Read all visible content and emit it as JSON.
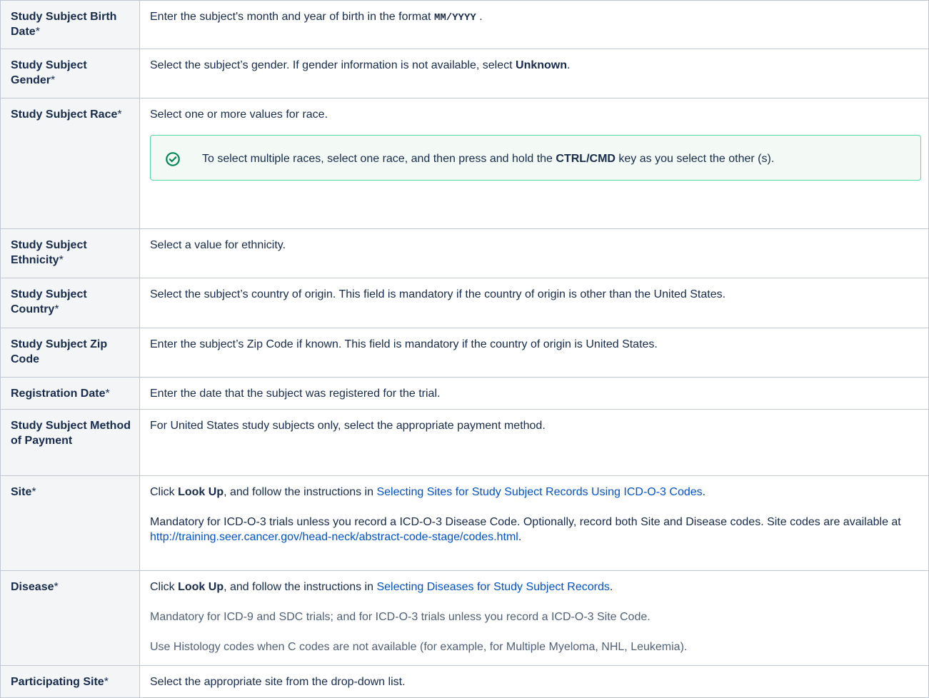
{
  "rows": [
    {
      "label": "Study Subject Birth Date",
      "req": "*",
      "desc_pre": "Enter the subject's month and year of birth in the format ",
      "desc_code": "MM/YYYY",
      "desc_post": " ."
    },
    {
      "label": "Study Subject Gender",
      "req": "*",
      "desc_pre": "Select the subject’s gender. If gender information is not available, select ",
      "desc_bold": "Unknown",
      "desc_post": "."
    },
    {
      "label": "Study Subject Race",
      "req": "*",
      "desc": "Select one or more values for race.",
      "tip_pre": "To select multiple races, select one race, and then press and hold the ",
      "tip_bold": "CTRL/CMD",
      "tip_post": " key as you select the other (s).",
      "tip_icon": "check-circle-icon",
      "tip_color": "#00875a"
    },
    {
      "label": "Study Subject Ethnicity",
      "req": "*",
      "desc": "Select a value for ethnicity."
    },
    {
      "label": "Study Subject Country",
      "req": "*",
      "desc": "Select the subject’s country of origin. This field is mandatory if the country of origin is other than the United States."
    },
    {
      "label": "Study Subject Zip Code",
      "req": "",
      "desc": "Enter the subject’s Zip Code if known. This field is mandatory if the country of origin is United States."
    },
    {
      "label": "Registration Date",
      "req": "*",
      "desc": "Enter the date that the subject was registered for the trial."
    },
    {
      "label": "Study Subject Method of Payment",
      "req": "",
      "desc": "For United States study subjects only, select the appropriate payment method."
    },
    {
      "label": "Site",
      "req": "*",
      "p1_pre": "Click ",
      "p1_bold": "Look Up",
      "p1_mid": ", and follow the instructions in ",
      "p1_link": "Selecting Sites for Study Subject Records Using ICD-O-3 Codes",
      "p1_post": ".",
      "p2_pre": "Mandatory for ICD-O-3 trials unless you record a ICD-O-3 Disease Code. Optionally, record both Site and Disease codes. Site codes are available at ",
      "p2_link": "http://training.seer.cancer.gov/head-neck/abstract-code-stage/codes.html",
      "p2_post": "."
    },
    {
      "label": "Disease",
      "req": "*",
      "p1_pre": "Click ",
      "p1_bold": "Look Up",
      "p1_mid": ", and follow the instructions in ",
      "p1_link": "Selecting Diseases for Study Subject Records",
      "p1_post": ".",
      "p2": "Mandatory for ICD-9 and SDC trials; and for ICD-O-3 trials unless you record a ICD-O-3 Site Code.",
      "p3": "Use Histology codes when C codes are not available (for example, for Multiple Myeloma, NHL, Leukemia)."
    },
    {
      "label": "Participating Site",
      "req": "*",
      "desc": "Select the appropriate site from the drop-down list."
    }
  ],
  "colors": {
    "link": "#0052cc",
    "label_bg": "#f4f5f7",
    "tip_border": "#57d9a3",
    "tip_bg": "#f3f9f4"
  }
}
